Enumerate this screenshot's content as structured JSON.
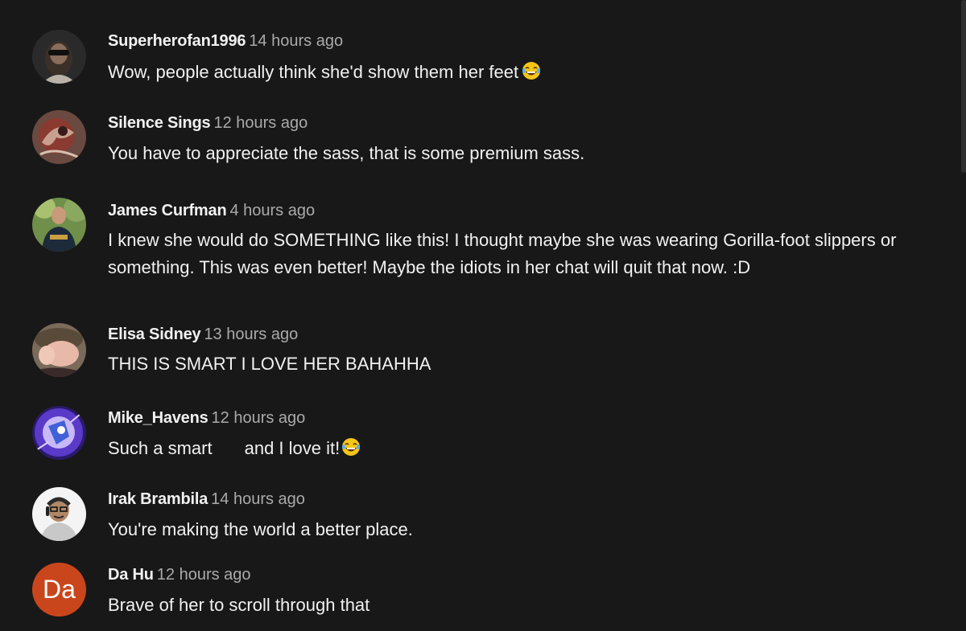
{
  "comments": [
    {
      "author": "Superherofan1996",
      "time": "14 hours ago",
      "text": "Wow, people actually think she'd show them her feet",
      "emoji": "laughing-tears"
    },
    {
      "author": "Silence Sings",
      "time": "12 hours ago",
      "text": "You have to appreciate the sass, that is some premium sass."
    },
    {
      "author": "James Curfman",
      "time": "4 hours ago",
      "text": "I knew she would do SOMETHING like this! I thought maybe she was wearing Gorilla-foot slippers or something. This was even better! Maybe the idiots in her chat will quit that now. :D"
    },
    {
      "author": "Elisa Sidney",
      "time": "13 hours ago",
      "text": "THIS IS SMART I LOVE HER BAHAHHA"
    },
    {
      "author": "Mike_Havens",
      "time": "12 hours ago",
      "text_a": "Such a smart",
      "text_b": "and I love it!",
      "emoji": "laughing-tears"
    },
    {
      "author": "Irak Brambila",
      "time": "14 hours ago",
      "text": "You're making the world a better place."
    },
    {
      "author": "Da Hu",
      "time": "12 hours ago",
      "text": "Brave of her to scroll through that",
      "avatar_letters": "Da",
      "avatar_color": "#c9461c"
    }
  ]
}
